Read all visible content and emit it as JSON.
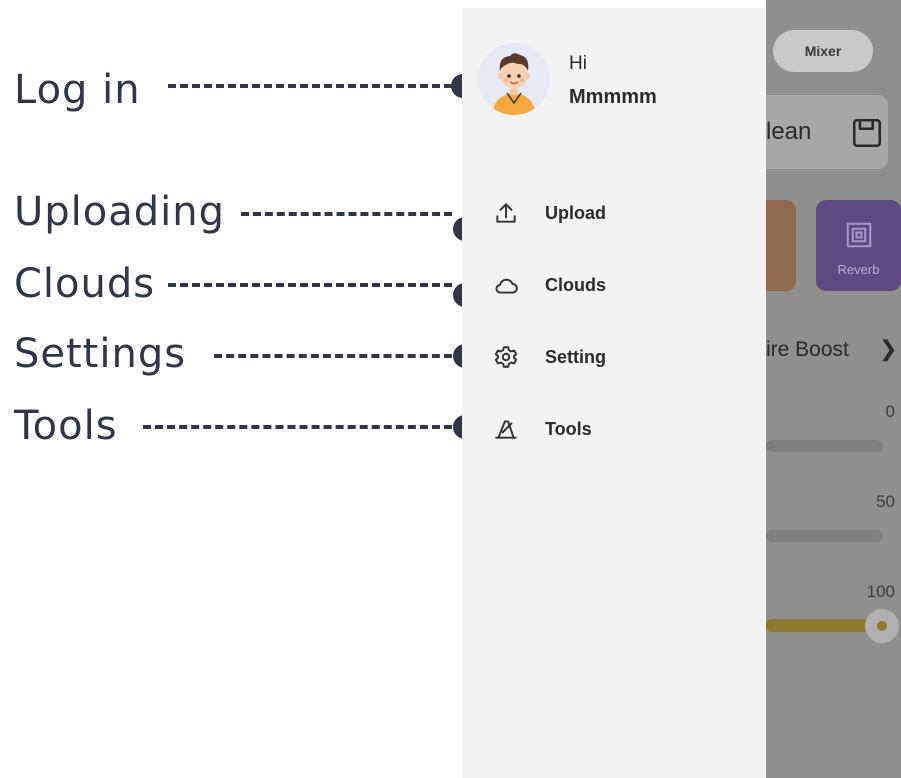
{
  "annotations": {
    "items": [
      {
        "label": "Log in"
      },
      {
        "label": "Uploading"
      },
      {
        "label": "Clouds"
      },
      {
        "label": "Settings"
      },
      {
        "label": "Tools"
      }
    ],
    "color": "#2f3747"
  },
  "drawer": {
    "greeting": "Hi",
    "username": "Mmmmm",
    "menu": [
      {
        "label": "Upload",
        "icon": "upload-icon"
      },
      {
        "label": "Clouds",
        "icon": "cloud-icon"
      },
      {
        "label": "Setting",
        "icon": "gear-icon"
      },
      {
        "label": "Tools",
        "icon": "tools-icon"
      }
    ]
  },
  "background_app": {
    "mixer_label": "Mixer",
    "preset_name": "lean",
    "effect_label": "Reverb",
    "boost_label": "ire Boost",
    "sliders": [
      {
        "value_label": "0",
        "fraction": 0
      },
      {
        "value_label": "50",
        "fraction": 0
      },
      {
        "value_label": "100",
        "fraction": 1
      }
    ],
    "accent_color": "#e6c84a"
  }
}
